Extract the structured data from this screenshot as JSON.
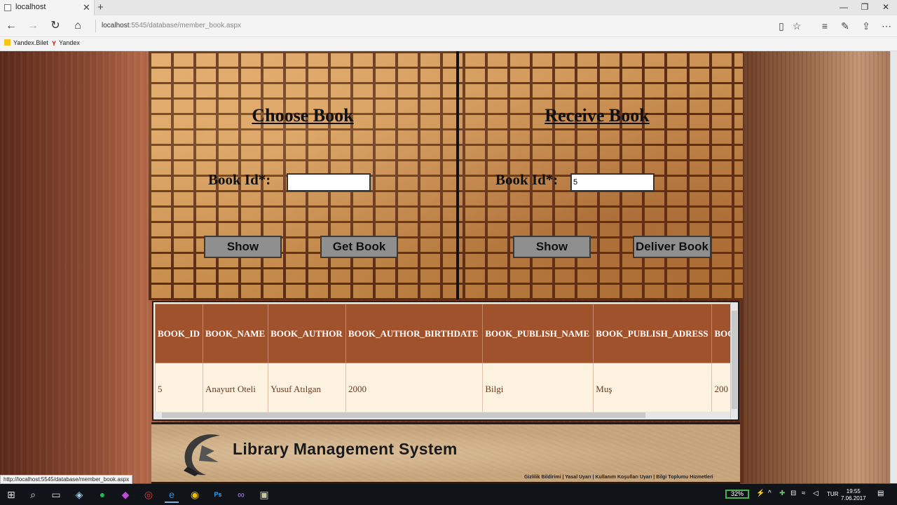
{
  "browser": {
    "tab_title": "localhost",
    "url_host": "localhost",
    "url_path": ":5545/database/member_book.aspx",
    "favorites": [
      "Yandex.Bilet",
      "Yandex"
    ],
    "status_url": "http://localhost:5545/database/member_book.aspx"
  },
  "choose": {
    "title": "Choose Book",
    "label": "Book Id*:",
    "value": "",
    "show_label": "Show",
    "action_label": "Get Book"
  },
  "receive": {
    "title": "Receive Book",
    "label": "Book Id*:",
    "value": "5",
    "show_label": "Show",
    "action_label": "Deliver Book"
  },
  "grid": {
    "columns": [
      "BOOK_ID",
      "BOOK_NAME",
      "BOOK_AUTHOR",
      "BOOK_AUTHOR_BIRTHDATE",
      "BOOK_PUBLISH_NAME",
      "BOOK_PUBLISH_ADRESS",
      "BOO"
    ],
    "rows": [
      [
        "5",
        "Anayurt Oteli",
        "Yusuf Atılgan",
        "2000",
        "Bilgi",
        "Muş",
        "200"
      ]
    ]
  },
  "footer": {
    "title": "Library Management System",
    "links": "Gizlilik Bildirimi  |  Yasal Uyarı  |  Kullanım Koşulları Uyarı  |  Bilgi Toplumu Hizmetleri"
  },
  "taskbar": {
    "battery": "32%",
    "language": "TUR",
    "time": "19:55",
    "date": "7.06.2017"
  },
  "colors": {
    "header_bg": "#a0522d",
    "row_bg": "#fdf1e0",
    "button_bg": "#8f8f8f"
  }
}
